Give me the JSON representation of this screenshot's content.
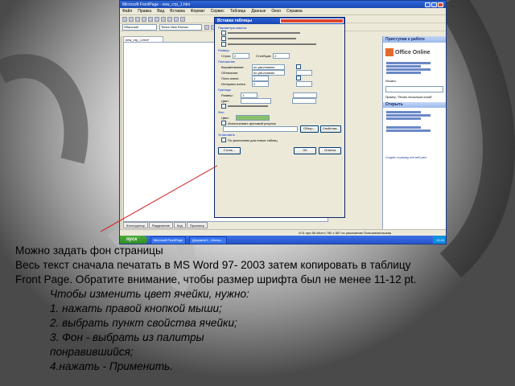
{
  "window": {
    "title": "Microsoft FrontPage - new_стр_1.htm",
    "menu": [
      "Файл",
      "Правка",
      "Вид",
      "Вставка",
      "Формат",
      "Сервис",
      "Таблица",
      "Данные",
      "Окно",
      "Справка"
    ],
    "doc_tab": "new_стр_1.htm*",
    "style_combo": "Обычный",
    "font_combo": "Times New Roman",
    "view_tabs": [
      "Конструктор",
      "Разделение",
      "Код",
      "Просмотр"
    ],
    "status": "0:01 при 56 кбит/с   780 x 567   по умолчанию   Пользовательская",
    "taskbar": {
      "start": "пуск",
      "items": [
        "Microsoft FrontPage",
        "Документ1 - Micros..."
      ],
      "time": "12:40"
    }
  },
  "task_pane": {
    "title": "Приступая к работе",
    "office_logo_text": "Office Online",
    "search_label": "Искать:",
    "example": "Пример: \"Печать нескольких копий\"",
    "open_header": "Открыть",
    "new_page": "Создать страницу или веб-узел"
  },
  "dialog": {
    "title": "Вставка таблицы",
    "sections": [
      "Параметры макета",
      "Размер",
      "Положение",
      "Границы",
      "Фон"
    ],
    "rows_label": "Строк:",
    "rows_value": "2",
    "cols_label": "Столбцов:",
    "cols_value": "2",
    "align_label": "Выравнивание:",
    "align_value": "по умолчанию",
    "float_label": "Обтекание:",
    "float_value": "по умолчанию",
    "padding_label": "Поля ячеек:",
    "padding_value": "1",
    "spacing_label": "Интервал ячеек:",
    "spacing_value": "2",
    "border_size_label": "Размер:",
    "border_size_value": "1",
    "border_color_label": "Цвет:",
    "bg_color_label": "Цвет:",
    "bg_image_label": "Использовать фоновый рисунок",
    "browse_button": "Обзор...",
    "props_button": "Свойства...",
    "set_label": "Установить",
    "default_label": "По умолчанию для новых таблиц",
    "style_button": "Стиль...",
    "ok_button": "ОК",
    "cancel_button": "Отмена"
  },
  "caption": {
    "line1": "Можно задать фон страницы",
    "line2": "Весь текст сначала печатать в MS Word 97- 2003 затем копировать в таблицу",
    "line3": "Front Page. Обратите внимание, чтобы размер шрифта был не менее 11-12 pt.",
    "instructions": [
      "Чтобы изменить цвет ячейки, нужно:",
      "1. нажать правой кнопкой мыши;",
      "2. выбрать пункт свойства ячейки;",
      "3. Фон - выбрать из палитры",
      "понравившийся;",
      "4.нажать - Применить."
    ]
  }
}
